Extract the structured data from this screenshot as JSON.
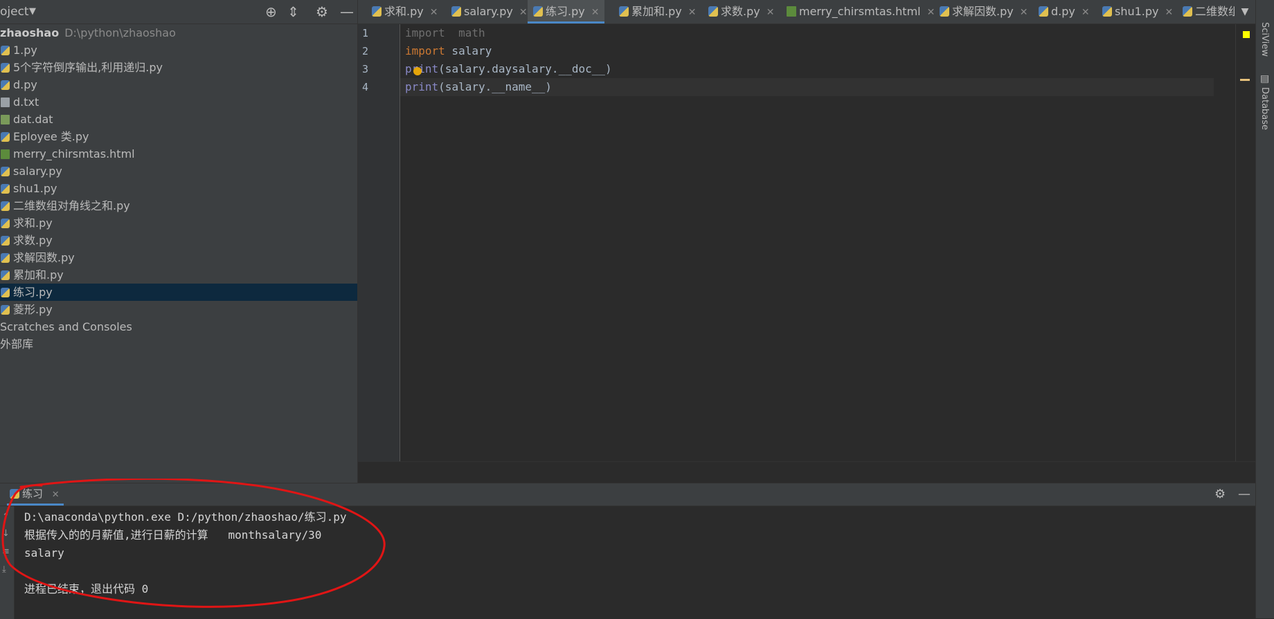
{
  "project_panel": {
    "title": "oject",
    "root_name": "zhaoshao",
    "root_path": "D:\\python\\zhaoshao",
    "files": [
      {
        "name": "1.py",
        "type": "py"
      },
      {
        "name": "5个字符倒序输出,利用递归.py",
        "type": "py"
      },
      {
        "name": "d.py",
        "type": "py"
      },
      {
        "name": "d.txt",
        "type": "txt"
      },
      {
        "name": "dat.dat",
        "type": "dat"
      },
      {
        "name": "Eployee 类.py",
        "type": "py"
      },
      {
        "name": "merry_chirsmtas.html",
        "type": "html"
      },
      {
        "name": "salary.py",
        "type": "py"
      },
      {
        "name": "shu1.py",
        "type": "py"
      },
      {
        "name": "二维数组对角线之和.py",
        "type": "py"
      },
      {
        "name": "求和.py",
        "type": "py"
      },
      {
        "name": "求数.py",
        "type": "py"
      },
      {
        "name": "求解因数.py",
        "type": "py"
      },
      {
        "name": "累加和.py",
        "type": "py"
      },
      {
        "name": "练习.py",
        "type": "py",
        "selected": true
      },
      {
        "name": "菱形.py",
        "type": "py"
      }
    ],
    "extra_nodes": [
      "Scratches and Consoles",
      "外部库"
    ]
  },
  "editor_tabs": [
    {
      "label": "求和.py",
      "type": "py"
    },
    {
      "label": "salary.py",
      "type": "py"
    },
    {
      "label": "练习.py",
      "type": "py",
      "active": true
    },
    {
      "label": "累加和.py",
      "type": "py"
    },
    {
      "label": "求数.py",
      "type": "py"
    },
    {
      "label": "merry_chirsmtas.html",
      "type": "html"
    },
    {
      "label": "求解因数.py",
      "type": "py"
    },
    {
      "label": "d.py",
      "type": "py"
    },
    {
      "label": "shu1.py",
      "type": "py"
    },
    {
      "label": "二维数组",
      "type": "py"
    }
  ],
  "editor": {
    "line_numbers": [
      "1",
      "2",
      "3",
      "4"
    ],
    "lines": [
      {
        "kw": "import",
        "rest": "  math"
      },
      {
        "kw": "import",
        "rest": " salary"
      },
      {
        "fn": "print",
        "rest": "(salary.daysalary.__doc__)"
      },
      {
        "fn": "print",
        "rest": "(salary.__name__)"
      }
    ]
  },
  "right_strip": {
    "sciview": "SciView",
    "database": "Database"
  },
  "run_panel": {
    "tab_label": "练习",
    "console_lines": [
      "D:\\anaconda\\python.exe D:/python/zhaoshao/练习.py",
      "根据传入的的月薪值,进行日薪的计算   monthsalary/30",
      "salary",
      "",
      "进程已结束，退出代码 0"
    ]
  },
  "colors": {
    "selection": "#0d293e",
    "accent_tab": "#4a88c7",
    "annotation": "#e01515"
  }
}
